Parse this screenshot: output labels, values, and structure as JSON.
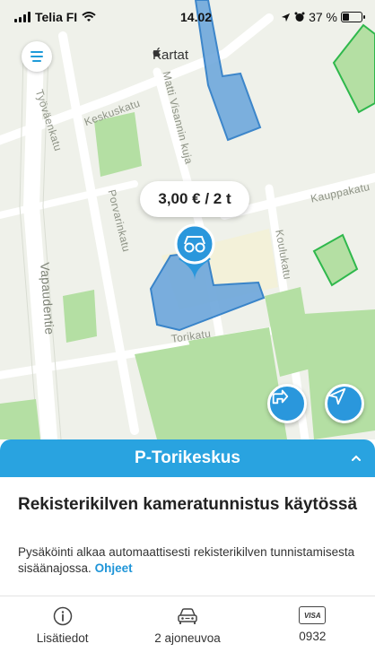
{
  "status_bar": {
    "carrier": "Telia FI",
    "time": "14.02",
    "battery": "37 %",
    "battery_level": 0.37
  },
  "map": {
    "provider": "Kartat",
    "streets": {
      "tyovaenkatu": "Työväenkatu",
      "keskuskatu": "Keskuskatu",
      "matti_visannin_kuja": "Matti Visannin kuja",
      "porvarinkatu": "Porvarinkatu",
      "kauppakatu": "Kauppakatu",
      "koulukatu": "Koulukatu",
      "vapaudentie": "Vapaudentie",
      "torikatu": "Torikatu"
    },
    "price_label": "3,00 € / 2 t",
    "colors": {
      "parking_fill": "#6fa8dc",
      "parking_stroke": "#2a7bc7",
      "park_fill": "#b4dfa3",
      "accent": "#2a97dc"
    }
  },
  "sheet": {
    "title": "P-Torikeskus",
    "info_title": "Rekisterikilven kameratunnistus käytössä",
    "info_body": "Pysäköinti alkaa automaattisesti rekisterikilven tunnistamisesta sisäänajossa.",
    "info_link": "Ohjeet",
    "actions": [
      {
        "icon": "info-icon",
        "label": "Lisätiedot"
      },
      {
        "icon": "car-icon",
        "label": "2 ajoneuvoa"
      },
      {
        "icon": "visa-card-icon",
        "card_text": "VISA",
        "label": "0932"
      }
    ]
  }
}
